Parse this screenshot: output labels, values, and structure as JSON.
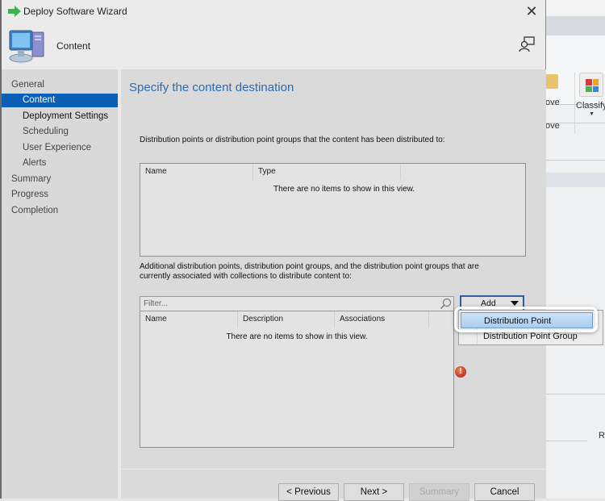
{
  "window": {
    "title": "Deploy Software Wizard",
    "header_title": "Content",
    "close_glyph": "✕"
  },
  "sidebar": {
    "items": [
      {
        "label": "General",
        "level": 0,
        "state": "normal"
      },
      {
        "label": "Content",
        "level": 1,
        "state": "active"
      },
      {
        "label": "Deployment Settings",
        "level": 1,
        "state": "bold"
      },
      {
        "label": "Scheduling",
        "level": 1,
        "state": "normal"
      },
      {
        "label": "User Experience",
        "level": 1,
        "state": "normal"
      },
      {
        "label": "Alerts",
        "level": 1,
        "state": "normal"
      },
      {
        "label": "Summary",
        "level": 0,
        "state": "normal"
      },
      {
        "label": "Progress",
        "level": 0,
        "state": "normal"
      },
      {
        "label": "Completion",
        "level": 0,
        "state": "normal"
      }
    ]
  },
  "main": {
    "page_title": "Specify the content destination",
    "distributed_desc": "Distribution points or distribution point groups that the content has been distributed to:",
    "distributed_list": {
      "columns": [
        "Name",
        "Type"
      ],
      "empty_message": "There are no items to show in this view."
    },
    "additional_desc": "Additional distribution points, distribution point groups, and the distribution point groups that are currently associated with collections to distribute content to:",
    "filter_placeholder": "Filter...",
    "additional_list": {
      "columns": [
        "Name",
        "Description",
        "Associations"
      ],
      "empty_message": "There are no items to show in this view."
    },
    "add_button": "Add",
    "error_glyph": "!"
  },
  "add_menu": {
    "items": [
      {
        "label": "Distribution Point",
        "highlighted": true
      },
      {
        "label": "Distribution Point Group",
        "highlighted": false
      }
    ]
  },
  "footer": {
    "previous": "< Previous",
    "next": "Next >",
    "summary": "Summary",
    "cancel": "Cancel"
  },
  "background_app": {
    "move_label_1": "ove",
    "move_label_2": "ove",
    "classify_label": "Classify",
    "r_label": "R"
  },
  "colors": {
    "accent": "#0b5fb7",
    "title_blue": "#2b6cb3",
    "error_red": "#c1361a"
  }
}
